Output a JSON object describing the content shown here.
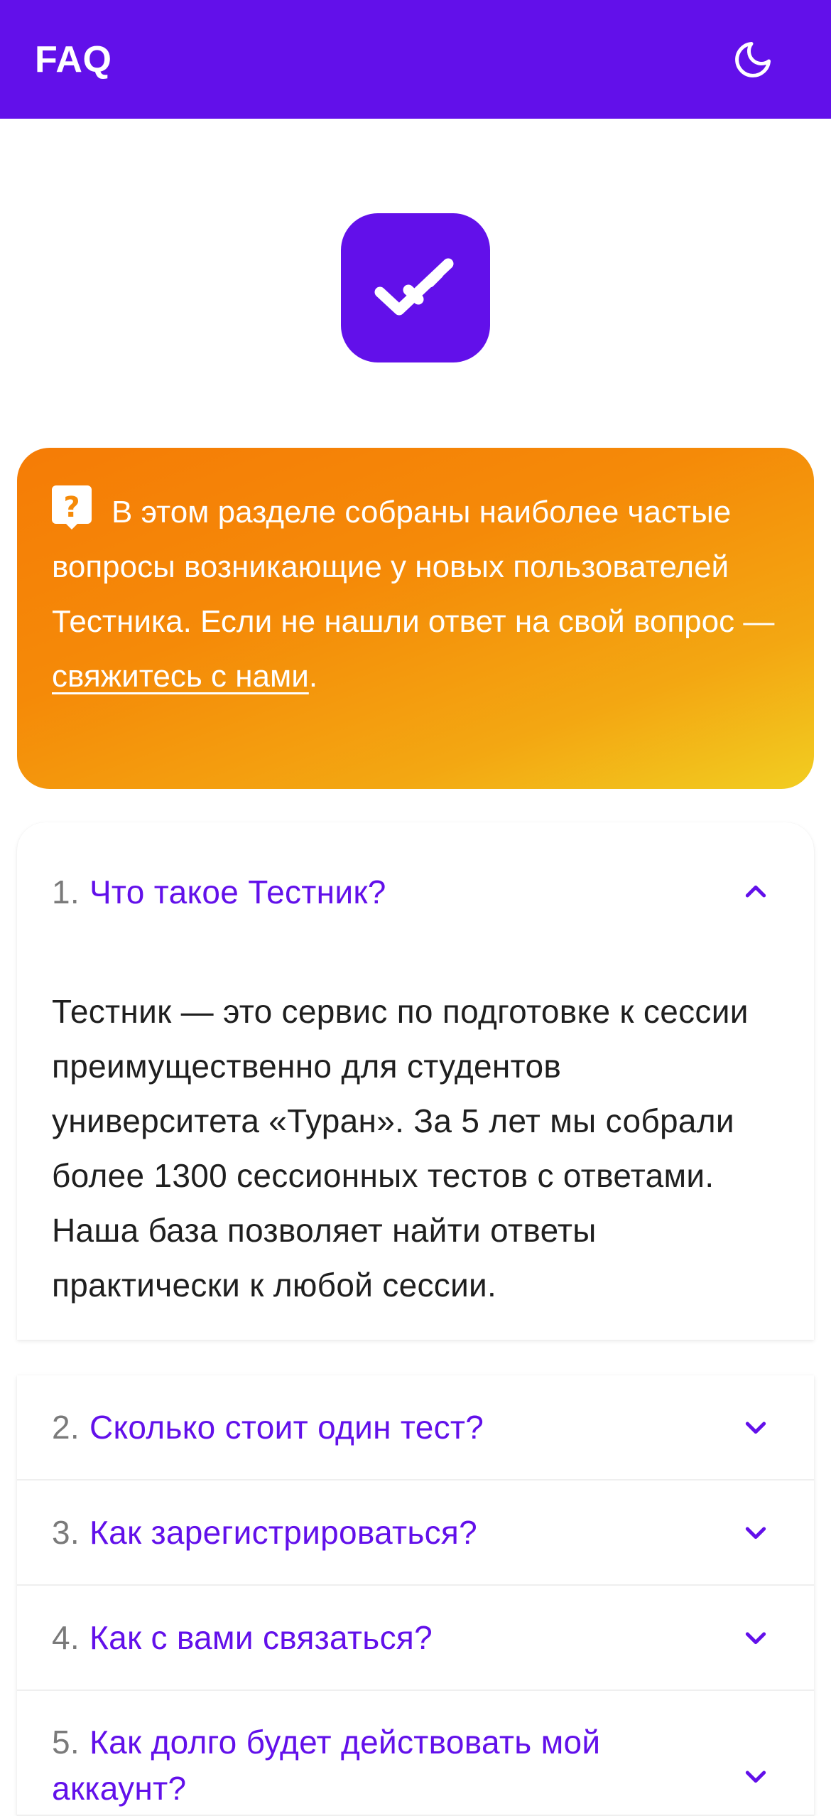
{
  "header": {
    "title": "FAQ",
    "theme_icon": "moon-icon"
  },
  "logo": {
    "icon": "double-check-icon",
    "color": "#6210ea"
  },
  "intro": {
    "icon": "question-bubble-icon",
    "text": "В этом разделе собраны наиболее частые вопросы возникающие у новых пользователей Тестника. Если не нашли ответ на свой вопрос — ",
    "link_text": "свяжитесь с нами",
    "trailing": "."
  },
  "faq": [
    {
      "number": "1.",
      "question": "Что такое Тестник?",
      "expanded": true,
      "answer": "Тестник — это сервис по подготовке к сессии преимущественно для студентов университета «Туран». За 5 лет мы собрали более 1300 сессионных тестов с ответами. Наша база позволяет найти ответы практически к любой сессии."
    },
    {
      "number": "2.",
      "question": "Сколько стоит один тест?",
      "expanded": false
    },
    {
      "number": "3.",
      "question": "Как зарегистрироваться?",
      "expanded": false
    },
    {
      "number": "4.",
      "question": "Как с вами связаться?",
      "expanded": false
    },
    {
      "number": "5.",
      "question": "Как долго будет действовать мой аккаунт?",
      "expanded": false
    }
  ],
  "colors": {
    "accent": "#6210ea",
    "intro_gradient_start": "#f57c06",
    "intro_gradient_end": "#f2cd21"
  }
}
